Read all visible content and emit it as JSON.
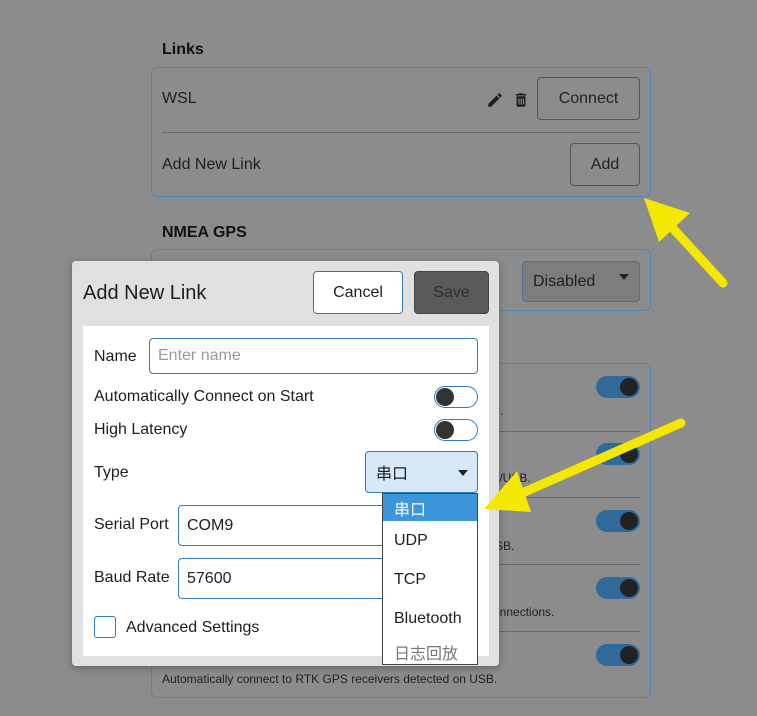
{
  "links": {
    "title": "Links",
    "items": [
      {
        "name": "WSL",
        "action_label": "Connect"
      }
    ],
    "add_label": "Add New Link",
    "add_button": "Add"
  },
  "nmea": {
    "title": "NMEA GPS",
    "select_value": "Disabled"
  },
  "background_rows": {
    "visible_texts": [
      ".",
      "al/USB.",
      "SB.",
      "onnections."
    ],
    "last_description": "Automatically connect to RTK GPS receivers detected on USB."
  },
  "dialog": {
    "title": "Add New Link",
    "cancel_label": "Cancel",
    "save_label": "Save",
    "name_label": "Name",
    "name_placeholder": "Enter name",
    "auto_connect_label": "Automatically Connect on Start",
    "high_latency_label": "High Latency",
    "type_label": "Type",
    "type_value": "串口",
    "serial_port_label": "Serial Port",
    "serial_port_value": "COM9",
    "baud_rate_label": "Baud Rate",
    "baud_rate_value": "57600",
    "advanced_label": "Advanced Settings"
  },
  "type_options": [
    "串口",
    "UDP",
    "TCP",
    "Bluetooth",
    "日志回放"
  ],
  "colors": {
    "accent": "#2f7ab8",
    "selected": "#3c97da",
    "annotation_arrow": "#f5e800"
  }
}
